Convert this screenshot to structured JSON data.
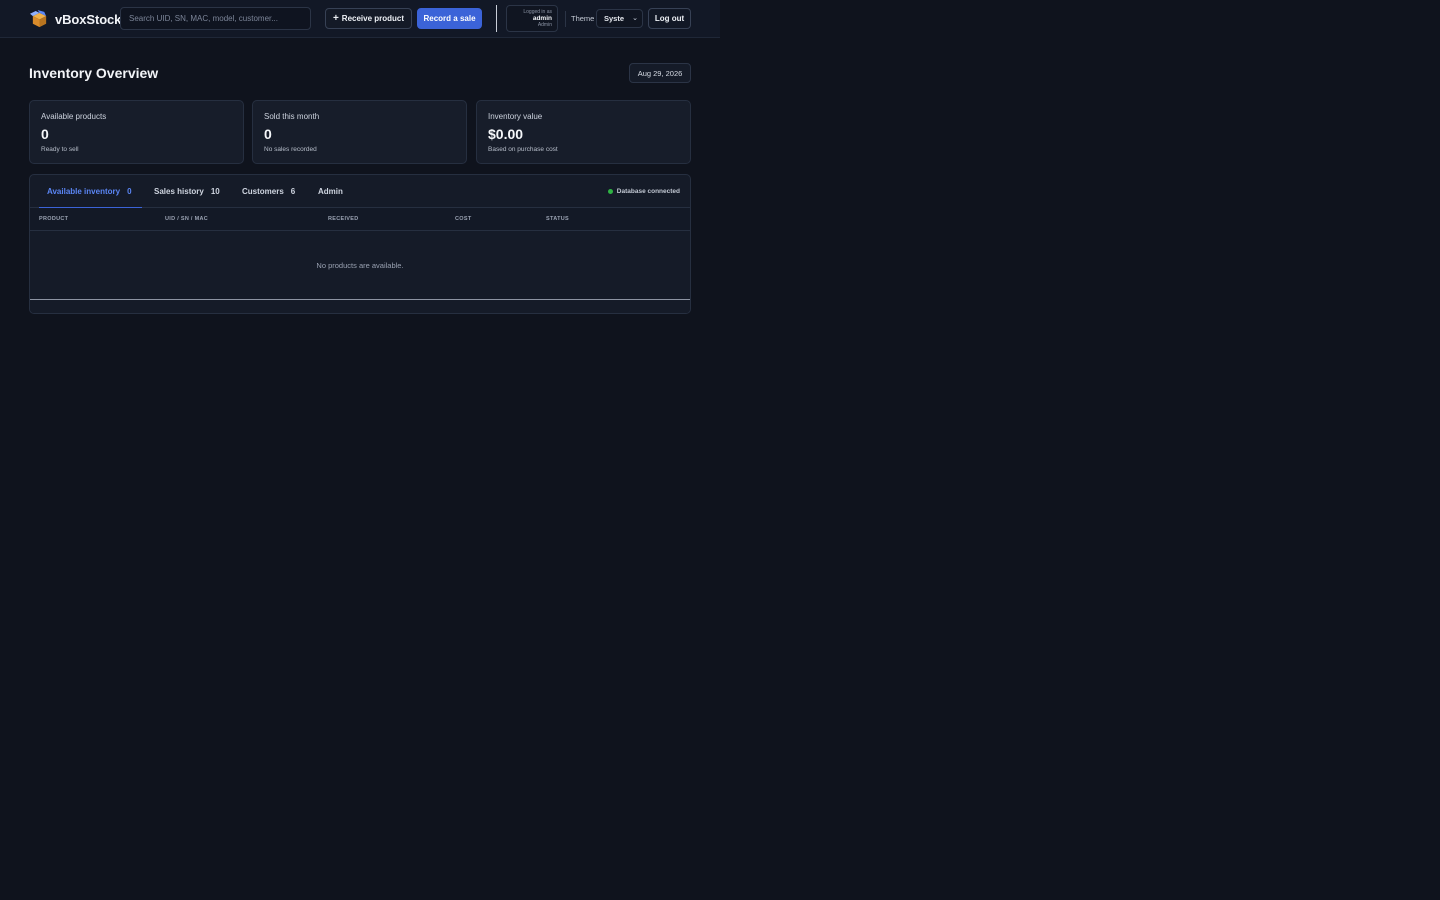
{
  "header": {
    "app_name": "vBoxStock",
    "search_placeholder": "Search UID, SN, MAC, model, customer...",
    "receive_label": "Receive product",
    "record_sale_label": "Record a sale",
    "user": {
      "logged_in_label": "Logged in as",
      "username": "admin",
      "role": "Admin"
    },
    "theme_label": "Theme",
    "theme_value": "Syste",
    "logout_label": "Log out"
  },
  "page": {
    "title": "Inventory Overview",
    "date": "Aug 29, 2026"
  },
  "stats": [
    {
      "label": "Available products",
      "value": "0",
      "sub": "Ready to sell"
    },
    {
      "label": "Sold this month",
      "value": "0",
      "sub": "No sales recorded"
    },
    {
      "label": "Inventory value",
      "value": "$0.00",
      "sub": "Based on purchase cost"
    }
  ],
  "tabs": [
    {
      "label": "Available inventory",
      "count": "0",
      "active": true
    },
    {
      "label": "Sales history",
      "count": "10"
    },
    {
      "label": "Customers",
      "count": "6"
    },
    {
      "label": "Admin",
      "count": ""
    }
  ],
  "db_status": "Database connected",
  "table": {
    "columns": [
      "PRODUCT",
      "UID / SN / MAC",
      "RECEIVED",
      "COST",
      "STATUS"
    ],
    "empty_message": "No products are available."
  },
  "colors": {
    "background": "#0f131d",
    "accent": "#3b63d8",
    "active_tab": "#5b86f5",
    "status_ok": "#2fb344"
  },
  "icons": {
    "brand": "box-logo-icon",
    "receive": "plus-icon",
    "theme_select": "chevron-down-icon",
    "db_status": "status-dot-icon"
  }
}
